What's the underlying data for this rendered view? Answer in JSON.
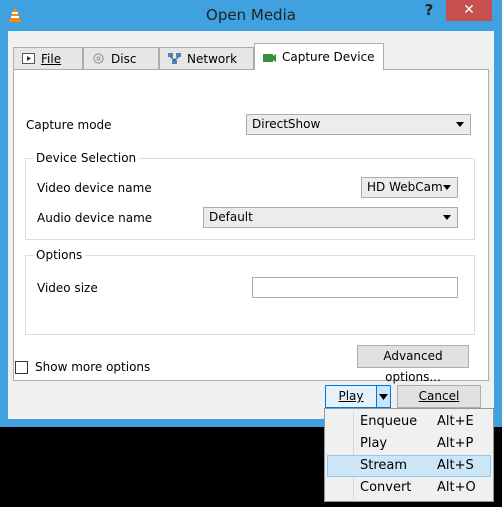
{
  "window": {
    "title": "Open Media",
    "help_label": "?",
    "close_label": "✕"
  },
  "tabs": [
    {
      "label": "File",
      "icon": "file-icon"
    },
    {
      "label": "Disc",
      "icon": "disc-icon"
    },
    {
      "label": "Network",
      "icon": "network-icon"
    },
    {
      "label": "Capture Device",
      "icon": "capture-device-icon",
      "active": true
    }
  ],
  "capture": {
    "mode_label": "Capture mode",
    "mode_value": "DirectShow"
  },
  "device_selection": {
    "title": "Device Selection",
    "video_label": "Video device name",
    "video_value": "HD WebCam",
    "audio_label": "Audio device name",
    "audio_value": "Default"
  },
  "options": {
    "title": "Options",
    "video_size_label": "Video size",
    "video_size_value": "",
    "advanced_label": "Advanced options..."
  },
  "footer": {
    "show_more_label": "Show more options",
    "show_more_checked": false,
    "play_label": "Play",
    "cancel_label": "Cancel"
  },
  "dropdown_menu": {
    "items": [
      {
        "label": "Enqueue",
        "shortcut": "Alt+E"
      },
      {
        "label": "Play",
        "shortcut": "Alt+P"
      },
      {
        "label": "Stream",
        "shortcut": "Alt+S",
        "highlighted": true
      },
      {
        "label": "Convert",
        "shortcut": "Alt+O"
      }
    ]
  },
  "colors": {
    "window_frame": "#3fa1e0",
    "close_button": "#c74f4f",
    "menu_highlight": "#cde6f7"
  }
}
